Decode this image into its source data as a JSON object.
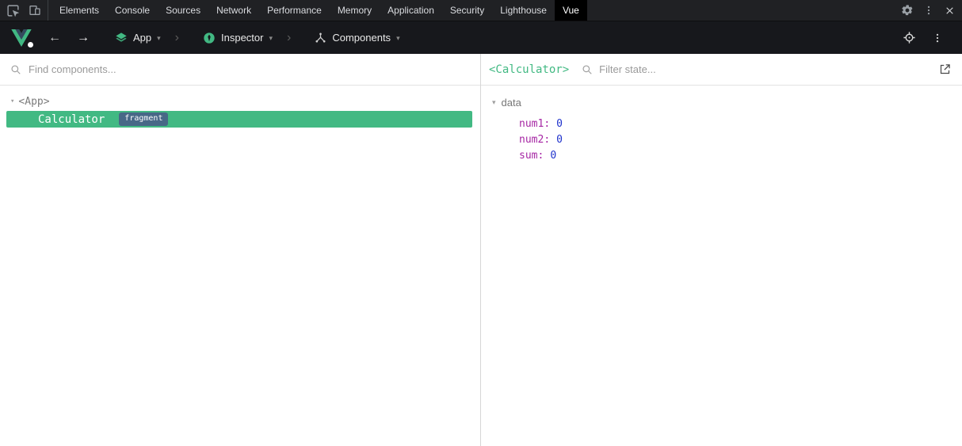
{
  "devtools": {
    "tabs": [
      "Elements",
      "Console",
      "Sources",
      "Network",
      "Performance",
      "Memory",
      "Application",
      "Security",
      "Lighthouse",
      "Vue"
    ],
    "active_tab": "Vue"
  },
  "toolbar": {
    "app_label": "App",
    "inspector_label": "Inspector",
    "components_label": "Components"
  },
  "left_panel": {
    "search_placeholder": "Find components...",
    "tree": {
      "root_tag": "<App>",
      "selected_component": "Calculator",
      "selected_badge": "fragment"
    }
  },
  "right_panel": {
    "component_tag": "<Calculator>",
    "filter_placeholder": "Filter state...",
    "section_label": "data",
    "state": [
      {
        "key": "num1",
        "value": "0"
      },
      {
        "key": "num2",
        "value": "0"
      },
      {
        "key": "sum",
        "value": "0"
      }
    ]
  },
  "icons": {
    "caret_down": "▾",
    "chevron_separator": "›",
    "back_arrow": "←",
    "forward_arrow": "→"
  },
  "colors": {
    "vue_green": "#42b983",
    "fragment_badge_blue": "#486887",
    "state_key_purple": "#a626a4",
    "state_value_blue": "#2033cc",
    "topbar_bg": "#202124",
    "vue_toolbar_bg": "#17181c"
  }
}
